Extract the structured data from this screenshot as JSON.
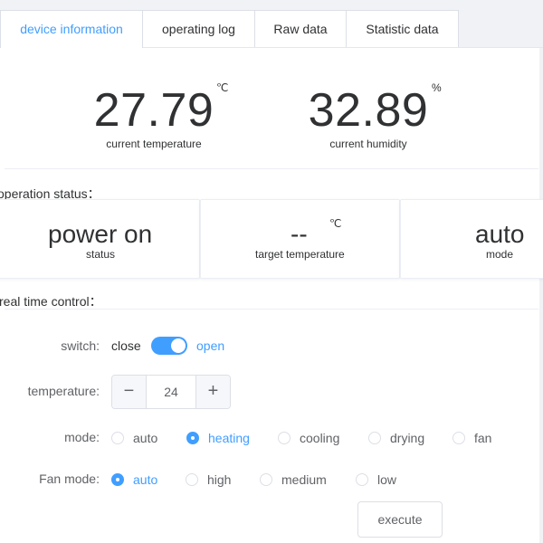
{
  "tabs": [
    {
      "label": "device information",
      "active": true
    },
    {
      "label": "operating log",
      "active": false
    },
    {
      "label": "Raw data",
      "active": false
    },
    {
      "label": "Statistic data",
      "active": false
    }
  ],
  "readings": {
    "temperature": {
      "value": "27.79",
      "unit": "℃",
      "label": "current temperature"
    },
    "humidity": {
      "value": "32.89",
      "unit": "%",
      "label": "current humidity"
    }
  },
  "operation_status": {
    "title": "operation status：",
    "status": {
      "value": "power on",
      "label": "status"
    },
    "target_temperature": {
      "value": "--",
      "unit": "℃",
      "label": "target temperature"
    },
    "mode": {
      "value": "auto",
      "label": "mode"
    }
  },
  "realtime_control": {
    "title": "real time control：",
    "switch": {
      "label": "switch:",
      "off_text": "close",
      "on_text": "open",
      "on": true
    },
    "temperature": {
      "label": "temperature:",
      "value": "24",
      "minus": "−",
      "plus": "+"
    },
    "mode": {
      "label": "mode:",
      "options": [
        "auto",
        "heating",
        "cooling",
        "drying",
        "fan"
      ],
      "selected": "heating"
    },
    "fan_mode": {
      "label": "Fan mode:",
      "options": [
        "auto",
        "high",
        "medium",
        "low"
      ],
      "selected": "auto"
    },
    "execute_label": "execute"
  },
  "colors": {
    "accent": "#409eff",
    "text": "#303133",
    "border": "#dcdfe6"
  }
}
